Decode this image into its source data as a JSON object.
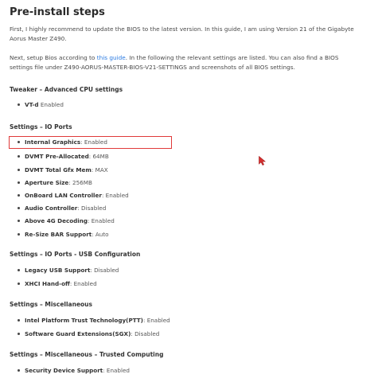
{
  "title": "Pre-install steps",
  "intro": {
    "line1": "First, I highly recommend to update the BIOS to the latest version. In this guide, I am using Version 21 of the Gigabyte",
    "line2": "Aorus Master Z490."
  },
  "setup": {
    "line1_before": "Next, setup Bios according to ",
    "line1_link": "this guide",
    "line1_after": ". In the following the relevant settings are listed. You can also find a BIOS",
    "line2": "settings file under Z490-AORUS-MASTER-BIOS-V21-SETTINGS and screenshots of all BIOS settings."
  },
  "sections": [
    {
      "heading": "Tweaker – Advanced CPU settings",
      "items": [
        {
          "key": "VT-d",
          "value": " Enabled"
        }
      ]
    },
    {
      "heading": "Settings – IO Ports",
      "items": [
        {
          "key": "Internal Graphics",
          "value": ": Enabled"
        },
        {
          "key": "DVMT Pre-Allocated",
          "value": ": 64MB"
        },
        {
          "key": "DVMT Total Gfx Mem",
          "value": ": MAX"
        },
        {
          "key": "Aperture Size",
          "value": ": 256MB"
        },
        {
          "key": "OnBoard LAN Controller",
          "value": ": Enabled"
        },
        {
          "key": "Audio Controller",
          "value": ": Disabled"
        },
        {
          "key": "Above 4G Decoding",
          "value": ": Enabled"
        },
        {
          "key": "Re-Size BAR Support",
          "value": ": Auto"
        }
      ]
    },
    {
      "heading": "Settings – IO Ports - USB Configuration",
      "items": [
        {
          "key": "Legacy USB Support",
          "value": ": Disabled"
        },
        {
          "key": "XHCI Hand-off",
          "value": ": Enabled"
        }
      ]
    },
    {
      "heading": "Settings – Miscellaneous",
      "items": [
        {
          "key": "Intel Platform Trust Technology(PTT)",
          "value": ": Enabled"
        },
        {
          "key": "Software Guard Extensions(SGX)",
          "value": ": Disabled"
        }
      ]
    },
    {
      "heading": "Settings – Miscellaneous – Trusted Computing",
      "items": [
        {
          "key": "Security Device Support",
          "value": ": Enabled"
        }
      ]
    }
  ],
  "colors": {
    "link": "#2a7ae2",
    "highlight_border": "#e03a3a",
    "cursor": "#d83030"
  },
  "icons": {
    "cursor": "mouse-pointer-icon"
  }
}
